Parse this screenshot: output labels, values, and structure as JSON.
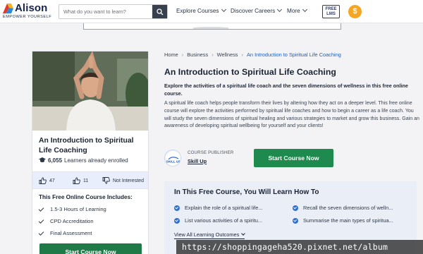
{
  "header": {
    "logo_name": "Alison",
    "logo_tagline": "EMPOWER YOURSELF",
    "search_placeholder": "What do you want to learn?",
    "nav": [
      {
        "label": "Explore Courses"
      },
      {
        "label": "Discover Careers"
      },
      {
        "label": "More"
      }
    ],
    "free_lms_line1": "FREE",
    "free_lms_line2": "LMS",
    "coin_symbol": "$"
  },
  "card": {
    "title": "An Introduction to Spiritual Life Coaching",
    "enrolled_count": "6,055",
    "enrolled_label": "Learners already enrolled",
    "likes": "47",
    "dislikes": "11",
    "not_interested": "Not Interested",
    "includes_title": "This Free Online Course Includes:",
    "includes": [
      "1.5-3 Hours of Learning",
      "CPD Accreditation",
      "Final Assessment"
    ],
    "cta": "Start Course Now"
  },
  "breadcrumb": {
    "items": [
      "Home",
      "Business",
      "Wellness"
    ],
    "current": "An Introduction to Spiritual Life Coaching"
  },
  "main": {
    "title": "An Introduction to Spiritual Life Coaching",
    "subtitle": "Explore the activities of a spiritual life coach and the seven dimensions of wellness in this free online course.",
    "description": "A spiritual life coach helps people transform their lives by altering how they act on a deeper level. This free online course will explore the activities performed by spiritual life coaches and how to begin a career as a life coach. You will study the seven dimensions of spiritual healing and various strategies to market and grow this business. Gain an awareness of developing spiritual wellbeing for yourself and your clients!",
    "publisher_label": "COURSE PUBLISHER",
    "publisher_name": "Skill Up",
    "publisher_logo_text": "SKILL UP",
    "cta": "Start Course Now"
  },
  "learn": {
    "title": "In This Free Course, You Will Learn How To",
    "outcomes": [
      "Explain the role of a spiritual life...",
      "Recall the seven dimensions of welln...",
      "List various activities of a spiritu...",
      "Summarise the main types of spiritua..."
    ],
    "view_all": "View All Learning Outcomes"
  },
  "colors": {
    "brand_navy": "#16244a",
    "cta_green": "#1f8a4d",
    "link_blue": "#1d5fb3",
    "accent_orange": "#f5a524"
  },
  "watermark": "https://shoppingageha520.pixnet.net/album"
}
